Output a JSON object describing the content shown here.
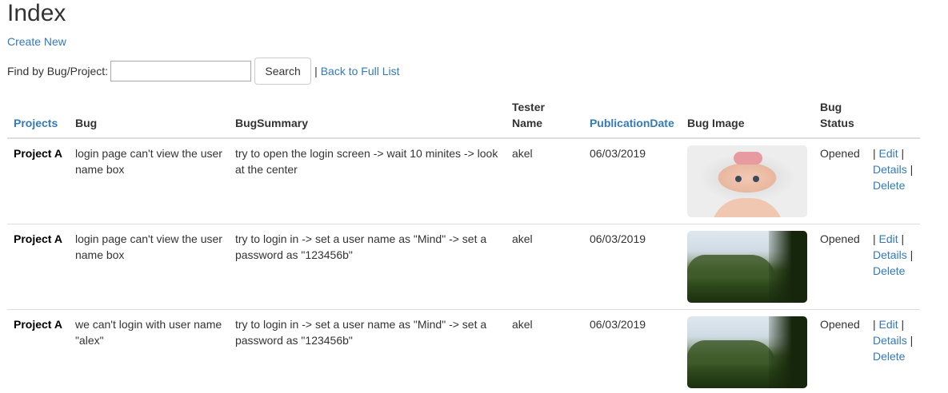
{
  "page": {
    "title": "Index",
    "create_new": "Create New"
  },
  "search": {
    "label": "Find by Bug/Project:",
    "value": "",
    "button": "Search",
    "separator": "|",
    "back_link": "Back to Full List"
  },
  "table": {
    "headers": {
      "projects": "Projects",
      "bug": "Bug",
      "bug_summary": "BugSummary",
      "tester_name": "Tester Name",
      "publication_date": "PublicationDate",
      "bug_image": "Bug Image",
      "bug_status": "Bug Status"
    },
    "rows": [
      {
        "project": "Project A",
        "bug": "login page can't view the user name box",
        "summary": "try to open the login screen -> wait 10 minites -> look at the center",
        "tester": "akel",
        "date": "06/03/2019",
        "image": "baby-photo",
        "status": "Opened"
      },
      {
        "project": "Project A",
        "bug": "login page can't view the user name box",
        "summary": "try to login in -> set a user name as \"Mind\" -> set a password as \"123456b\"",
        "tester": "akel",
        "date": "06/03/2019",
        "image": "landscape-photo",
        "status": "Opened"
      },
      {
        "project": "Project A",
        "bug": "we can't login with user name \"alex\"",
        "summary": "try to login in -> set a user name as \"Mind\" -> set a password as \"123456b\"",
        "tester": "akel",
        "date": "06/03/2019",
        "image": "landscape-photo",
        "status": "Opened"
      }
    ],
    "actions": {
      "pipe": "|",
      "edit": "Edit",
      "details": "Details",
      "delete": "Delete"
    }
  },
  "colors": {
    "link": "#337ab7",
    "border": "#dddddd",
    "text": "#333333"
  }
}
